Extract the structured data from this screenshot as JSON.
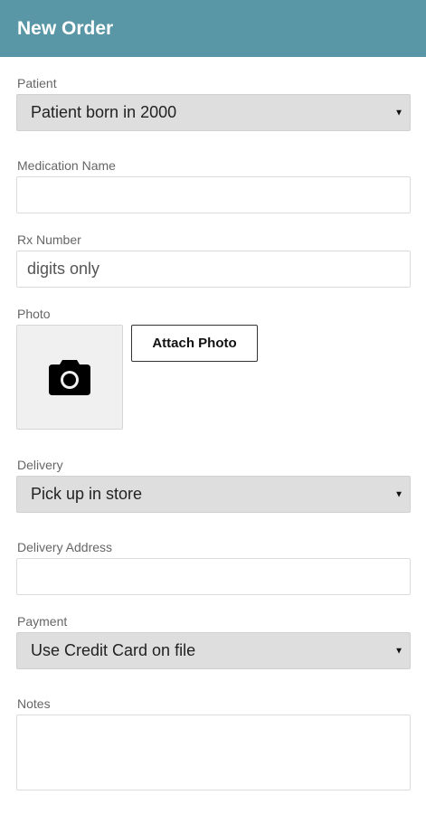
{
  "header": {
    "title": "New Order"
  },
  "form": {
    "patient": {
      "label": "Patient",
      "value": "Patient born in 2000"
    },
    "medication": {
      "label": "Medication Name",
      "value": ""
    },
    "rx_number": {
      "label": "Rx Number",
      "placeholder": "digits only"
    },
    "photo": {
      "label": "Photo",
      "attach_label": "Attach Photo",
      "icon": "camera-icon"
    },
    "delivery": {
      "label": "Delivery",
      "value": "Pick up in store"
    },
    "delivery_address": {
      "label": "Delivery Address",
      "value": ""
    },
    "payment": {
      "label": "Payment",
      "value": "Use Credit Card on file"
    },
    "notes": {
      "label": "Notes",
      "value": ""
    }
  },
  "colors": {
    "header_bg": "#5a97a6",
    "select_bg": "#dedede"
  }
}
